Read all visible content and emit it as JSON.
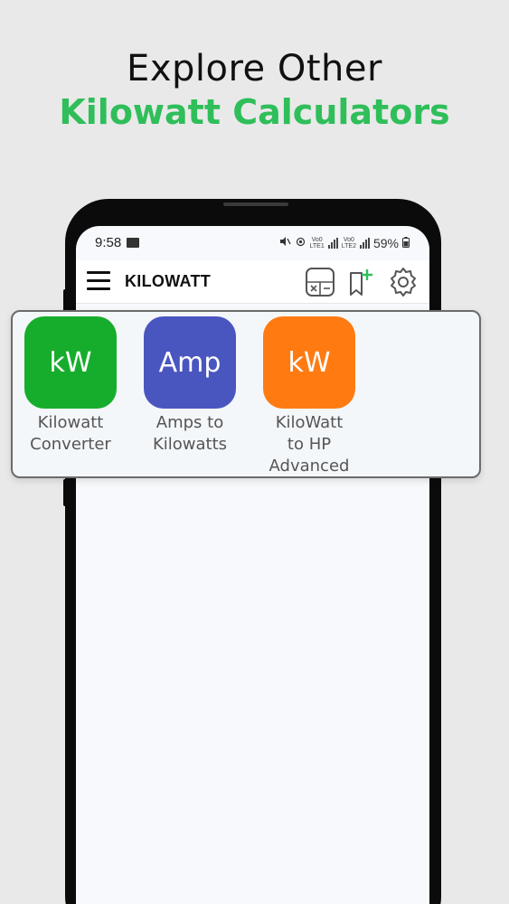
{
  "headline": {
    "line1": "Explore Other",
    "line2": "Kilowatt Calculators"
  },
  "status_bar": {
    "time": "9:58",
    "sim1": "Vo0\nLTE1",
    "sim2": "Vo0\nLTE2",
    "battery": "59%"
  },
  "app_bar": {
    "title": "KILOWATT",
    "icons": [
      "menu-icon",
      "calculator-icon",
      "bookmark-add-icon",
      "gear-icon"
    ]
  },
  "calculators": [
    {
      "icon_text": "kW",
      "label": "Kilowatt\nConverter",
      "color": "#17ad2c"
    },
    {
      "icon_text": "Amp",
      "label": "Amps to\nKilowatts",
      "color": "#4a56bf"
    },
    {
      "icon_text": "kW",
      "label": "KiloWatt\nto HP\nAdvanced",
      "color": "#ff7b12"
    }
  ],
  "colors": {
    "accent_green": "#2fbe5a",
    "background": "#e9e9e9"
  }
}
